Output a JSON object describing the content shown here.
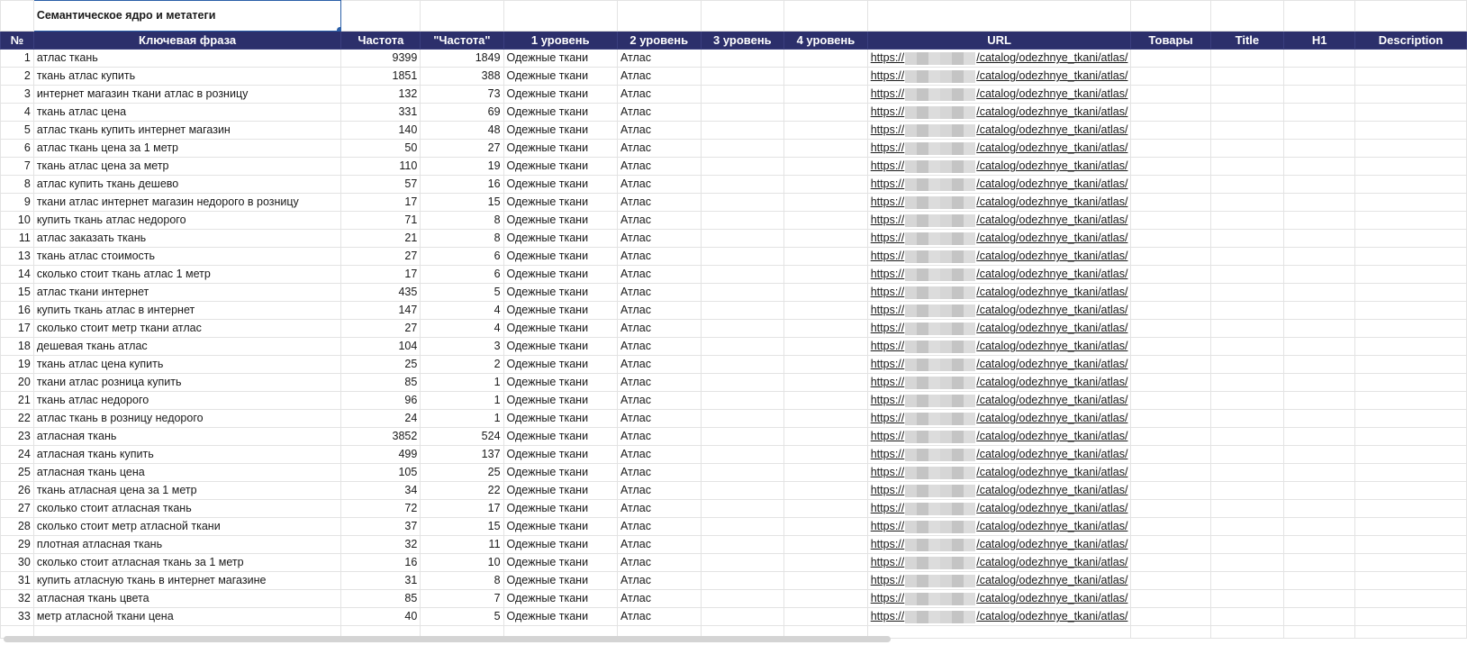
{
  "sheet_title": "Семантическое ядро и метатеги",
  "columns": [
    "№",
    "Ключевая фраза",
    "Частота",
    "\"Частота\"",
    "1 уровень",
    "2 уровень",
    "3 уровень",
    "4 уровень",
    "URL",
    "Товары",
    "Title",
    "H1",
    "Description"
  ],
  "url_prefix": "https://",
  "url_suffix": "/catalog/odezhnye_tkani/atlas/",
  "rows": [
    {
      "n": "1",
      "phrase": "атлас ткань",
      "freq": "9399",
      "freq_exact": "1849",
      "l1": "Одежные ткани",
      "l2": "Атлас"
    },
    {
      "n": "2",
      "phrase": "ткань атлас купить",
      "freq": "1851",
      "freq_exact": "388",
      "l1": "Одежные ткани",
      "l2": "Атлас"
    },
    {
      "n": "3",
      "phrase": "интернет магазин ткани атлас в розницу",
      "freq": "132",
      "freq_exact": "73",
      "l1": "Одежные ткани",
      "l2": "Атлас"
    },
    {
      "n": "4",
      "phrase": "ткань атлас цена",
      "freq": "331",
      "freq_exact": "69",
      "l1": "Одежные ткани",
      "l2": "Атлас"
    },
    {
      "n": "5",
      "phrase": "атлас ткань купить интернет магазин",
      "freq": "140",
      "freq_exact": "48",
      "l1": "Одежные ткани",
      "l2": "Атлас"
    },
    {
      "n": "6",
      "phrase": "атлас ткань цена за 1 метр",
      "freq": "50",
      "freq_exact": "27",
      "l1": "Одежные ткани",
      "l2": "Атлас"
    },
    {
      "n": "7",
      "phrase": "ткань атлас цена за метр",
      "freq": "110",
      "freq_exact": "19",
      "l1": "Одежные ткани",
      "l2": "Атлас"
    },
    {
      "n": "8",
      "phrase": "атлас купить ткань дешево",
      "freq": "57",
      "freq_exact": "16",
      "l1": "Одежные ткани",
      "l2": "Атлас"
    },
    {
      "n": "9",
      "phrase": "ткани атлас интернет магазин недорого в розницу",
      "freq": "17",
      "freq_exact": "15",
      "l1": "Одежные ткани",
      "l2": "Атлас"
    },
    {
      "n": "10",
      "phrase": "купить ткань атлас недорого",
      "freq": "71",
      "freq_exact": "8",
      "l1": "Одежные ткани",
      "l2": "Атлас"
    },
    {
      "n": "11",
      "phrase": "атлас заказать ткань",
      "freq": "21",
      "freq_exact": "8",
      "l1": "Одежные ткани",
      "l2": "Атлас"
    },
    {
      "n": "13",
      "phrase": "ткань атлас стоимость",
      "freq": "27",
      "freq_exact": "6",
      "l1": "Одежные ткани",
      "l2": "Атлас"
    },
    {
      "n": "14",
      "phrase": "сколько стоит ткань атлас 1 метр",
      "freq": "17",
      "freq_exact": "6",
      "l1": "Одежные ткани",
      "l2": "Атлас"
    },
    {
      "n": "15",
      "phrase": "атлас ткани интернет",
      "freq": "435",
      "freq_exact": "5",
      "l1": "Одежные ткани",
      "l2": "Атлас"
    },
    {
      "n": "16",
      "phrase": "купить ткань атлас в интернет",
      "freq": "147",
      "freq_exact": "4",
      "l1": "Одежные ткани",
      "l2": "Атлас"
    },
    {
      "n": "17",
      "phrase": "сколько стоит метр ткани атлас",
      "freq": "27",
      "freq_exact": "4",
      "l1": "Одежные ткани",
      "l2": "Атлас"
    },
    {
      "n": "18",
      "phrase": "дешевая ткань атлас",
      "freq": "104",
      "freq_exact": "3",
      "l1": "Одежные ткани",
      "l2": "Атлас"
    },
    {
      "n": "19",
      "phrase": "ткань атлас цена купить",
      "freq": "25",
      "freq_exact": "2",
      "l1": "Одежные ткани",
      "l2": "Атлас"
    },
    {
      "n": "20",
      "phrase": "ткани атлас розница купить",
      "freq": "85",
      "freq_exact": "1",
      "l1": "Одежные ткани",
      "l2": "Атлас"
    },
    {
      "n": "21",
      "phrase": "ткань атлас недорого",
      "freq": "96",
      "freq_exact": "1",
      "l1": "Одежные ткани",
      "l2": "Атлас"
    },
    {
      "n": "22",
      "phrase": "атлас ткань в розницу недорого",
      "freq": "24",
      "freq_exact": "1",
      "l1": "Одежные ткани",
      "l2": "Атлас"
    },
    {
      "n": "23",
      "phrase": "атласная ткань",
      "freq": "3852",
      "freq_exact": "524",
      "l1": "Одежные ткани",
      "l2": "Атлас"
    },
    {
      "n": "24",
      "phrase": "атласная ткань купить",
      "freq": "499",
      "freq_exact": "137",
      "l1": "Одежные ткани",
      "l2": "Атлас"
    },
    {
      "n": "25",
      "phrase": "атласная ткань цена",
      "freq": "105",
      "freq_exact": "25",
      "l1": "Одежные ткани",
      "l2": "Атлас"
    },
    {
      "n": "26",
      "phrase": "ткань атласная цена за 1 метр",
      "freq": "34",
      "freq_exact": "22",
      "l1": "Одежные ткани",
      "l2": "Атлас"
    },
    {
      "n": "27",
      "phrase": "сколько стоит атласная ткань",
      "freq": "72",
      "freq_exact": "17",
      "l1": "Одежные ткани",
      "l2": "Атлас"
    },
    {
      "n": "28",
      "phrase": "сколько стоит метр атласной ткани",
      "freq": "37",
      "freq_exact": "15",
      "l1": "Одежные ткани",
      "l2": "Атлас"
    },
    {
      "n": "29",
      "phrase": "плотная атласная ткань",
      "freq": "32",
      "freq_exact": "11",
      "l1": "Одежные ткани",
      "l2": "Атлас"
    },
    {
      "n": "30",
      "phrase": "сколько стоит атласная ткань за 1 метр",
      "freq": "16",
      "freq_exact": "10",
      "l1": "Одежные ткани",
      "l2": "Атлас"
    },
    {
      "n": "31",
      "phrase": "купить атласную ткань в интернет магазине",
      "freq": "31",
      "freq_exact": "8",
      "l1": "Одежные ткани",
      "l2": "Атлас"
    },
    {
      "n": "32",
      "phrase": "атласная ткань цвета",
      "freq": "85",
      "freq_exact": "7",
      "l1": "Одежные ткани",
      "l2": "Атлас"
    },
    {
      "n": "33",
      "phrase": "метр атласной ткани цена",
      "freq": "40",
      "freq_exact": "5",
      "l1": "Одежные ткани",
      "l2": "Атлас"
    }
  ],
  "colors": {
    "header_bg": "#2c2f6b",
    "header_text": "#ffffff",
    "selection": "#2b5fa8",
    "grid": "#e3e3e3"
  }
}
